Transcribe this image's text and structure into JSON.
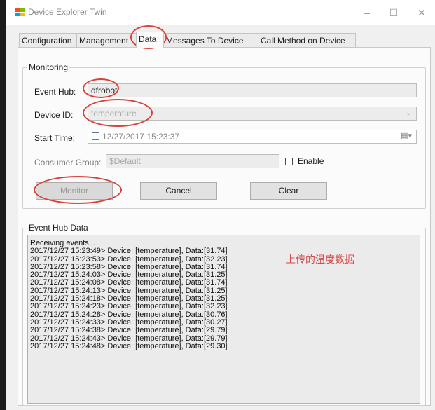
{
  "window": {
    "title": "Device Explorer Twin",
    "controls": {
      "minimize": "–",
      "maximize": "☐",
      "close": "✕"
    }
  },
  "tabs": [
    {
      "label": "Configuration",
      "active": false
    },
    {
      "label": "Management",
      "active": false
    },
    {
      "label": "Data",
      "active": true
    },
    {
      "label": "Messages To Device",
      "active": false
    },
    {
      "label": "Call Method on Device",
      "active": false
    }
  ],
  "monitoring": {
    "group_title": "Monitoring",
    "event_hub": {
      "label": "Event Hub:",
      "value": "dfrobot"
    },
    "device_id": {
      "label": "Device ID:",
      "value": "temperature"
    },
    "start_time": {
      "label": "Start Time:",
      "value": "12/27/2017 15:23:37"
    },
    "consumer_group": {
      "label": "Consumer Group:",
      "value": "$Default"
    },
    "enable": {
      "label": "Enable",
      "checked": false
    },
    "buttons": {
      "monitor": "Monitor",
      "cancel": "Cancel",
      "clear": "Clear"
    }
  },
  "event_hub_data": {
    "group_title": "Event Hub Data",
    "lines": [
      "Receiving events...",
      "2017/12/27 15:23:49> Device: [temperature], Data:[31.74]",
      "2017/12/27 15:23:53> Device: [temperature], Data:[32.23]",
      "2017/12/27 15:23:58> Device: [temperature], Data:[31.74]",
      "2017/12/27 15:24:03> Device: [temperature], Data:[31.25]",
      "2017/12/27 15:24:08> Device: [temperature], Data:[31.74]",
      "2017/12/27 15:24:13> Device: [temperature], Data:[31.25]",
      "2017/12/27 15:24:18> Device: [temperature], Data:[31.25]",
      "2017/12/27 15:24:23> Device: [temperature], Data:[32.23]",
      "2017/12/27 15:24:28> Device: [temperature], Data:[30.76]",
      "2017/12/27 15:24:33> Device: [temperature], Data:[30.27]",
      "2017/12/27 15:24:38> Device: [temperature], Data:[29.79]",
      "2017/12/27 15:24:43> Device: [temperature], Data:[29.79]",
      "2017/12/27 15:24:48> Device: [temperature], Data:[29.30]"
    ]
  },
  "annotation_note": "上传的温度数据",
  "colors": {
    "annotation": "#d9423b",
    "note": "#d24a4a",
    "window_bg": "#f0f0f0",
    "panel_bg": "#fbfbfb"
  }
}
